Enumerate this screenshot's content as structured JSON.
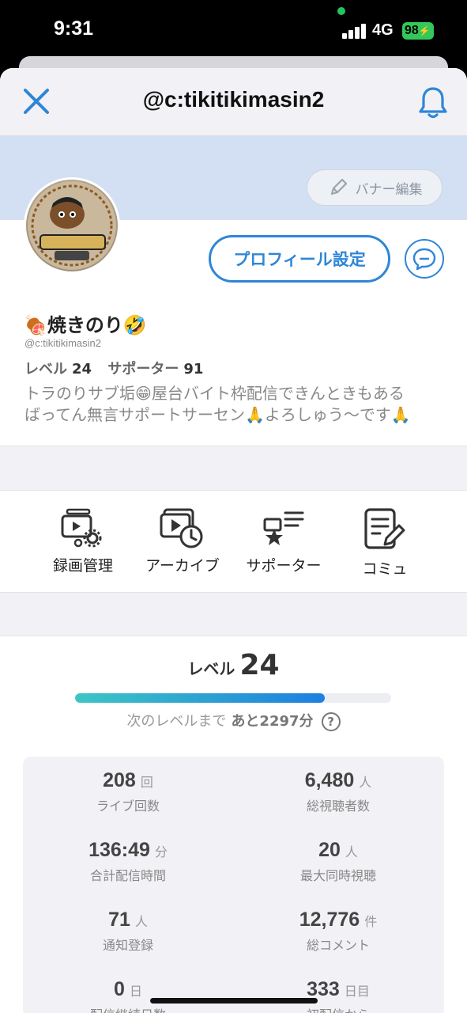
{
  "status_bar": {
    "time": "9:31",
    "network": "4G",
    "battery": "98"
  },
  "nav": {
    "title": "@c:tikitikimasin2",
    "close_icon": "close-icon",
    "bell_icon": "bell-icon"
  },
  "banner": {
    "edit_label": "バナー編集"
  },
  "profile": {
    "name": "🍖焼きのり🤣",
    "handle": "@c:tikitikimasin2",
    "level_label": "レベル",
    "level": "24",
    "supporter_label": "サポーター",
    "supporters": "91",
    "bio_line1": "トラのりサブ垢😁屋台バイト枠配信できんときもある",
    "bio_line2": "ばってん無言サポートサーセン🙏よろしゅう〜です🙏",
    "edit_button": "プロフィール設定"
  },
  "actions": [
    {
      "label": "録画管理",
      "icon": "recording-settings-icon"
    },
    {
      "label": "アーカイブ",
      "icon": "archive-icon"
    },
    {
      "label": "サポーター",
      "icon": "supporter-icon"
    },
    {
      "label": "コミュ",
      "icon": "community-icon"
    }
  ],
  "level_card": {
    "label": "レベル",
    "level": "24",
    "progress": 0.79,
    "next_label": "次のレベルまで",
    "next_value": "あと2297分",
    "help": "?"
  },
  "stats": [
    {
      "value": "208",
      "unit": "回",
      "label": "ライブ回数"
    },
    {
      "value": "6,480",
      "unit": "人",
      "label": "総視聴者数"
    },
    {
      "value": "136:49",
      "unit": "分",
      "label": "合計配信時間"
    },
    {
      "value": "20",
      "unit": "人",
      "label": "最大同時視聴"
    },
    {
      "value": "71",
      "unit": "人",
      "label": "通知登録"
    },
    {
      "value": "12,776",
      "unit": "件",
      "label": "総コメント"
    },
    {
      "value": "0",
      "unit": "日",
      "label": "配信継続日数"
    },
    {
      "value": "333",
      "unit": "日目",
      "label": "初配信から"
    }
  ],
  "colors": {
    "accent": "#2f86d8",
    "banner": "#d3e0f3",
    "progress_start": "#3cc6c4",
    "progress_end": "#1e7fe0"
  }
}
